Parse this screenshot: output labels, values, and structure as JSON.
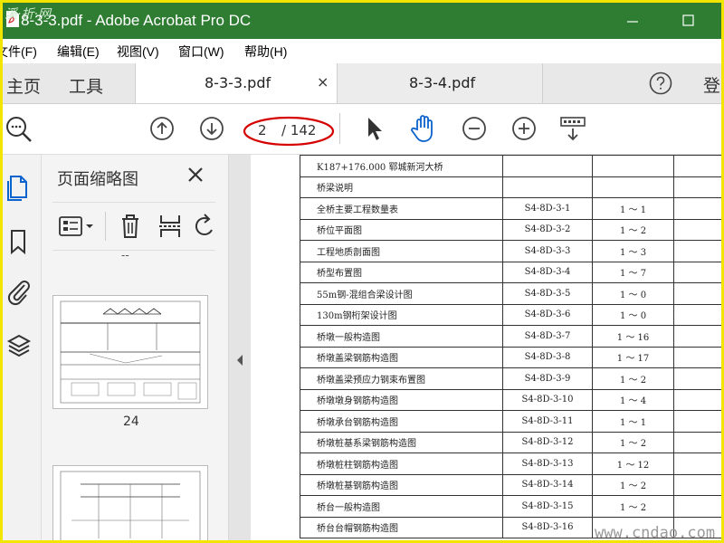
{
  "window": {
    "title": "8-3-3.pdf - Adobe Acrobat Pro DC",
    "watermark_text": "溪·折·网"
  },
  "menu": [
    "文件(F)",
    "编辑(E)",
    "视图(V)",
    "窗口(W)",
    "帮助(H)"
  ],
  "nav": {
    "home": "主页",
    "tools": "工具",
    "signin": "登"
  },
  "tabs": [
    {
      "label": "8-3-3.pdf",
      "close": "×",
      "active": true
    },
    {
      "label": "8-3-4.pdf",
      "active": false
    }
  ],
  "toolbar": {
    "page_current": "2",
    "page_total": "/ 142"
  },
  "thumbnails": {
    "title": "页面缩略图",
    "prev_label": "--",
    "page_label": "24"
  },
  "colors": {
    "titlebar": "#2e7d32",
    "accent": "#0b63ce",
    "highlight_ring": "#d50000"
  },
  "document": {
    "header": "K187+176.000   郓城新河大桥",
    "rows": [
      {
        "name": "桥梁说明",
        "code": "",
        "pages": ""
      },
      {
        "name": "全桥主要工程数量表",
        "code": "S4-8D-3-1",
        "pages": "1 ～ 1"
      },
      {
        "name": "桥位平面图",
        "code": "S4-8D-3-2",
        "pages": "1 ～ 2"
      },
      {
        "name": "工程地质剖面图",
        "code": "S4-8D-3-3",
        "pages": "1 ～ 3"
      },
      {
        "name": "桥型布置图",
        "code": "S4-8D-3-4",
        "pages": "1 ～ 7"
      },
      {
        "name": "55m钢-混组合梁设计图",
        "code": "S4-8D-3-5",
        "pages": "1 ～ 0"
      },
      {
        "name": "130m钢桁架设计图",
        "code": "S4-8D-3-6",
        "pages": "1 ～ 0"
      },
      {
        "name": "桥墩一般构造图",
        "code": "S4-8D-3-7",
        "pages": "1 ～ 16"
      },
      {
        "name": "桥墩盖梁钢筋构造图",
        "code": "S4-8D-3-8",
        "pages": "1 ～ 17"
      },
      {
        "name": "桥墩盖梁预应力钢束布置图",
        "code": "S4-8D-3-9",
        "pages": "1 ～ 2"
      },
      {
        "name": "桥墩墩身钢筋构造图",
        "code": "S4-8D-3-10",
        "pages": "1 ～ 4"
      },
      {
        "name": "桥墩承台钢筋构造图",
        "code": "S4-8D-3-11",
        "pages": "1 ～ 1"
      },
      {
        "name": "桥墩桩基系梁钢筋构造图",
        "code": "S4-8D-3-12",
        "pages": "1 ～ 2"
      },
      {
        "name": "桥墩桩柱钢筋构造图",
        "code": "S4-8D-3-13",
        "pages": "1 ～ 12"
      },
      {
        "name": "桥墩桩基钢筋构造图",
        "code": "S4-8D-3-14",
        "pages": "1 ～ 2"
      },
      {
        "name": "桥台一般构造图",
        "code": "S4-8D-3-15",
        "pages": "1 ～ 2"
      },
      {
        "name": "桥台台帽钢筋构造图",
        "code": "S4-8D-3-16",
        "pages": ""
      }
    ],
    "watermark": "www.cndao.com"
  }
}
